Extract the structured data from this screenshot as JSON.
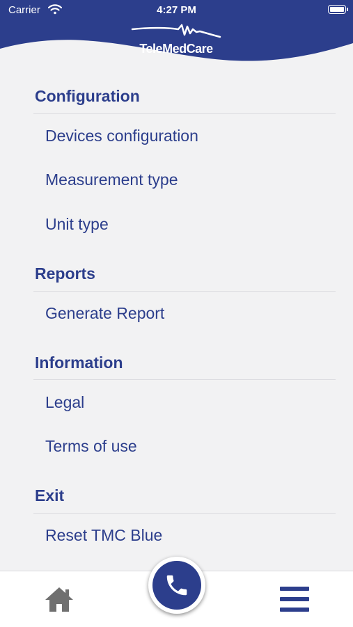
{
  "status_bar": {
    "carrier": "Carrier",
    "time": "4:27 PM"
  },
  "header": {
    "logo_text": "TeleMedCare",
    "brand_color": "#2c3e8c"
  },
  "menu": {
    "sections": [
      {
        "title": "Configuration",
        "items": [
          "Devices configuration",
          "Measurement type",
          "Unit type"
        ]
      },
      {
        "title": "Reports",
        "items": [
          "Generate Report"
        ]
      },
      {
        "title": "Information",
        "items": [
          "Legal",
          "Terms of use"
        ]
      },
      {
        "title": "Exit",
        "items": [
          "Reset TMC Blue"
        ]
      }
    ]
  },
  "tab_bar": {
    "left_icon": "home-icon",
    "center_icon": "phone-icon",
    "right_icon": "menu-icon"
  }
}
